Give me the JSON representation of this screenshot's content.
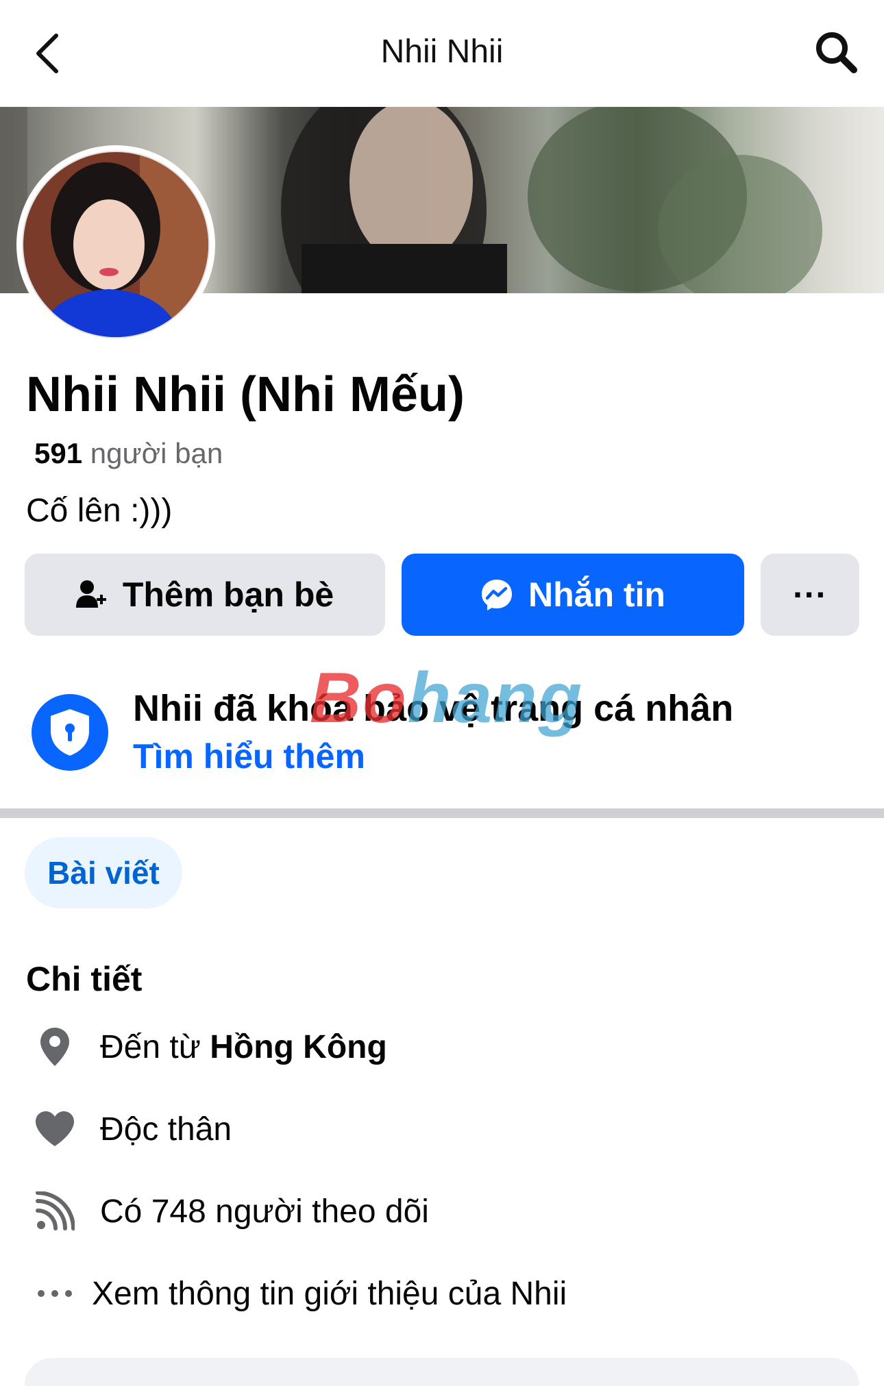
{
  "header": {
    "title": "Nhii Nhii"
  },
  "profile": {
    "name": "Nhii Nhii (Nhi Mếu)",
    "friends_count": "591",
    "friends_label": "người bạn",
    "bio": "Cố lên :)))"
  },
  "actions": {
    "add_friend": "Thêm bạn bè",
    "message": "Nhắn tin",
    "more": "···"
  },
  "lock_notice": {
    "title": "Nhii đã khóa bảo vệ trang cá nhân",
    "link": "Tìm hiểu thêm"
  },
  "watermark": {
    "part1": "Bo",
    "part2": "hang"
  },
  "tabs": {
    "posts": "Bài viết"
  },
  "details": {
    "title": "Chi tiết",
    "from_prefix": "Đến từ",
    "from_place": "Hồng Kông",
    "relationship": "Độc thân",
    "followers": "Có 748 người theo dõi",
    "see_about": "Xem thông tin giới thiệu của Nhii"
  },
  "colors": {
    "accent": "#0866ff",
    "button_gray": "#e4e6eb",
    "secondary_text": "#65676b",
    "tab_bg": "#ebf5ff",
    "tab_text": "#0064d1"
  },
  "icons": {
    "back": "chevron-left-icon",
    "search": "search-icon",
    "add_friend": "person-add-icon",
    "messenger": "messenger-icon",
    "lock": "shield-lock-icon",
    "location": "location-pin-icon",
    "relationship": "heart-icon",
    "followers": "rss-feed-icon",
    "more": "ellipsis-icon"
  }
}
